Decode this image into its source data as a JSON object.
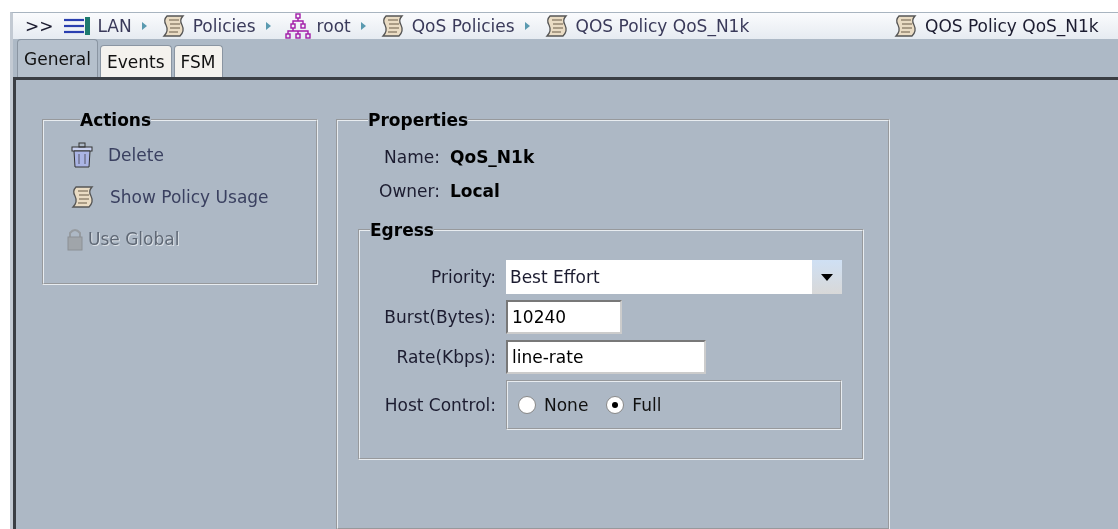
{
  "breadcrumb": {
    "prefix": ">>",
    "items": [
      {
        "label": "LAN",
        "kind": "list"
      },
      {
        "label": "Policies",
        "kind": "scroll"
      },
      {
        "label": "root",
        "kind": "tree"
      },
      {
        "label": "QoS Policies",
        "kind": "scroll"
      },
      {
        "label": "QOS Policy QoS_N1k",
        "kind": "scroll"
      }
    ],
    "title": {
      "label": "QOS Policy QoS_N1k",
      "kind": "scroll"
    }
  },
  "tabs": [
    {
      "label": "General",
      "selected": true
    },
    {
      "label": "Events",
      "selected": false
    },
    {
      "label": "FSM",
      "selected": false
    }
  ],
  "actions": {
    "title": "Actions",
    "items": [
      {
        "label": "Delete",
        "kind": "trash",
        "disabled": false
      },
      {
        "label": "Show Policy Usage",
        "kind": "scroll",
        "disabled": false
      },
      {
        "label": "Use Global",
        "kind": "lock",
        "disabled": true
      }
    ]
  },
  "properties": {
    "title": "Properties",
    "name_label": "Name:",
    "name": "QoS_N1k",
    "owner_label": "Owner:",
    "owner": "Local",
    "egress": {
      "title": "Egress",
      "priority_label": "Priority:",
      "priority": "Best Effort",
      "burst_label": "Burst(Bytes):",
      "burst": "10240",
      "rate_label": "Rate(Kbps):",
      "rate": "line-rate",
      "host_control_label": "Host Control:",
      "host_control": [
        {
          "label": "None",
          "selected": false
        },
        {
          "label": "Full",
          "selected": true
        }
      ]
    }
  }
}
